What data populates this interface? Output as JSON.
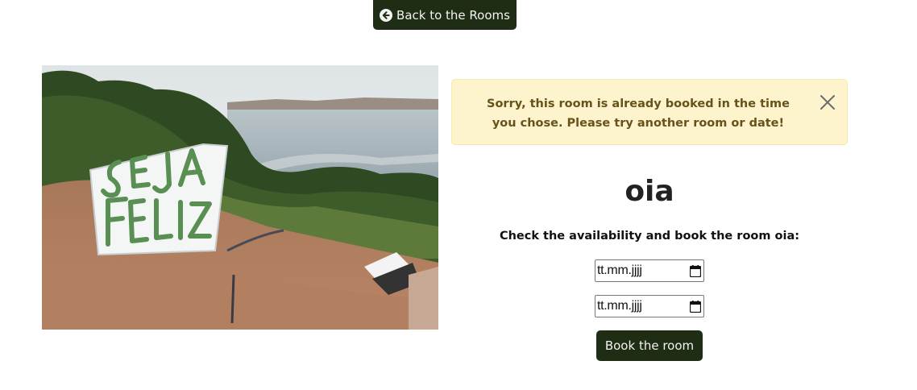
{
  "nav": {
    "back_label": "Back to the Rooms",
    "back_icon": "arrow-circle-left-icon"
  },
  "image": {
    "sign_text": "SEJA FELIZ"
  },
  "alert": {
    "message": "Sorry, this room is already booked in the time you chose. Please try another room or date!",
    "close_icon": "close-icon"
  },
  "room": {
    "title": "oia",
    "availability_text": "Check the availability and book the room oia:"
  },
  "booking": {
    "start_date_value": "tt.mm.jjjj",
    "end_date_value": "tt.mm.jjjj",
    "calendar_icon": "calendar-icon",
    "submit_label": "Book the room"
  },
  "colors": {
    "primary_button": "#1f2d14",
    "alert_background": "#fdf3cd",
    "alert_text": "#67531a"
  }
}
